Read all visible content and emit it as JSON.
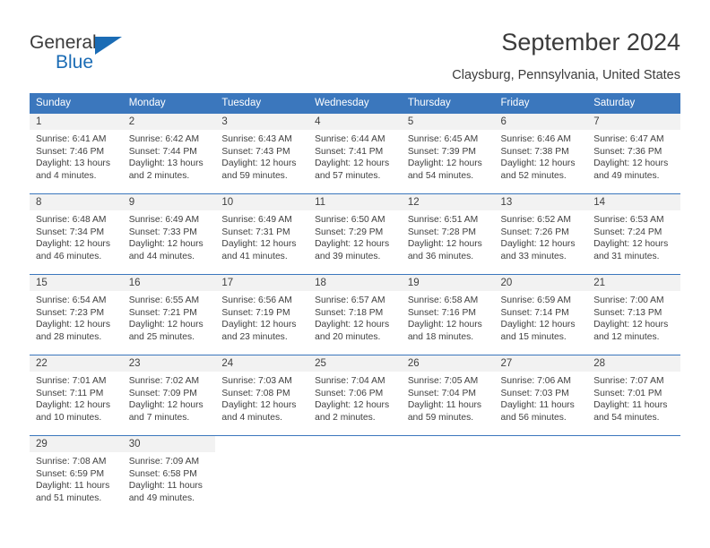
{
  "brand": {
    "name_part1": "General",
    "name_part2": "Blue",
    "triangle_color": "#1b6cb5"
  },
  "header": {
    "title": "September 2024",
    "subtitle": "Claysburg, Pennsylvania, United States"
  },
  "calendar": {
    "accent_color": "#3b77bd",
    "daynum_background": "#f2f2f2",
    "weekday_headers": [
      "Sunday",
      "Monday",
      "Tuesday",
      "Wednesday",
      "Thursday",
      "Friday",
      "Saturday"
    ],
    "weeks": [
      [
        {
          "day": "1",
          "sunrise": "Sunrise: 6:41 AM",
          "sunset": "Sunset: 7:46 PM",
          "daylight_line1": "Daylight: 13 hours",
          "daylight_line2": "and 4 minutes."
        },
        {
          "day": "2",
          "sunrise": "Sunrise: 6:42 AM",
          "sunset": "Sunset: 7:44 PM",
          "daylight_line1": "Daylight: 13 hours",
          "daylight_line2": "and 2 minutes."
        },
        {
          "day": "3",
          "sunrise": "Sunrise: 6:43 AM",
          "sunset": "Sunset: 7:43 PM",
          "daylight_line1": "Daylight: 12 hours",
          "daylight_line2": "and 59 minutes."
        },
        {
          "day": "4",
          "sunrise": "Sunrise: 6:44 AM",
          "sunset": "Sunset: 7:41 PM",
          "daylight_line1": "Daylight: 12 hours",
          "daylight_line2": "and 57 minutes."
        },
        {
          "day": "5",
          "sunrise": "Sunrise: 6:45 AM",
          "sunset": "Sunset: 7:39 PM",
          "daylight_line1": "Daylight: 12 hours",
          "daylight_line2": "and 54 minutes."
        },
        {
          "day": "6",
          "sunrise": "Sunrise: 6:46 AM",
          "sunset": "Sunset: 7:38 PM",
          "daylight_line1": "Daylight: 12 hours",
          "daylight_line2": "and 52 minutes."
        },
        {
          "day": "7",
          "sunrise": "Sunrise: 6:47 AM",
          "sunset": "Sunset: 7:36 PM",
          "daylight_line1": "Daylight: 12 hours",
          "daylight_line2": "and 49 minutes."
        }
      ],
      [
        {
          "day": "8",
          "sunrise": "Sunrise: 6:48 AM",
          "sunset": "Sunset: 7:34 PM",
          "daylight_line1": "Daylight: 12 hours",
          "daylight_line2": "and 46 minutes."
        },
        {
          "day": "9",
          "sunrise": "Sunrise: 6:49 AM",
          "sunset": "Sunset: 7:33 PM",
          "daylight_line1": "Daylight: 12 hours",
          "daylight_line2": "and 44 minutes."
        },
        {
          "day": "10",
          "sunrise": "Sunrise: 6:49 AM",
          "sunset": "Sunset: 7:31 PM",
          "daylight_line1": "Daylight: 12 hours",
          "daylight_line2": "and 41 minutes."
        },
        {
          "day": "11",
          "sunrise": "Sunrise: 6:50 AM",
          "sunset": "Sunset: 7:29 PM",
          "daylight_line1": "Daylight: 12 hours",
          "daylight_line2": "and 39 minutes."
        },
        {
          "day": "12",
          "sunrise": "Sunrise: 6:51 AM",
          "sunset": "Sunset: 7:28 PM",
          "daylight_line1": "Daylight: 12 hours",
          "daylight_line2": "and 36 minutes."
        },
        {
          "day": "13",
          "sunrise": "Sunrise: 6:52 AM",
          "sunset": "Sunset: 7:26 PM",
          "daylight_line1": "Daylight: 12 hours",
          "daylight_line2": "and 33 minutes."
        },
        {
          "day": "14",
          "sunrise": "Sunrise: 6:53 AM",
          "sunset": "Sunset: 7:24 PM",
          "daylight_line1": "Daylight: 12 hours",
          "daylight_line2": "and 31 minutes."
        }
      ],
      [
        {
          "day": "15",
          "sunrise": "Sunrise: 6:54 AM",
          "sunset": "Sunset: 7:23 PM",
          "daylight_line1": "Daylight: 12 hours",
          "daylight_line2": "and 28 minutes."
        },
        {
          "day": "16",
          "sunrise": "Sunrise: 6:55 AM",
          "sunset": "Sunset: 7:21 PM",
          "daylight_line1": "Daylight: 12 hours",
          "daylight_line2": "and 25 minutes."
        },
        {
          "day": "17",
          "sunrise": "Sunrise: 6:56 AM",
          "sunset": "Sunset: 7:19 PM",
          "daylight_line1": "Daylight: 12 hours",
          "daylight_line2": "and 23 minutes."
        },
        {
          "day": "18",
          "sunrise": "Sunrise: 6:57 AM",
          "sunset": "Sunset: 7:18 PM",
          "daylight_line1": "Daylight: 12 hours",
          "daylight_line2": "and 20 minutes."
        },
        {
          "day": "19",
          "sunrise": "Sunrise: 6:58 AM",
          "sunset": "Sunset: 7:16 PM",
          "daylight_line1": "Daylight: 12 hours",
          "daylight_line2": "and 18 minutes."
        },
        {
          "day": "20",
          "sunrise": "Sunrise: 6:59 AM",
          "sunset": "Sunset: 7:14 PM",
          "daylight_line1": "Daylight: 12 hours",
          "daylight_line2": "and 15 minutes."
        },
        {
          "day": "21",
          "sunrise": "Sunrise: 7:00 AM",
          "sunset": "Sunset: 7:13 PM",
          "daylight_line1": "Daylight: 12 hours",
          "daylight_line2": "and 12 minutes."
        }
      ],
      [
        {
          "day": "22",
          "sunrise": "Sunrise: 7:01 AM",
          "sunset": "Sunset: 7:11 PM",
          "daylight_line1": "Daylight: 12 hours",
          "daylight_line2": "and 10 minutes."
        },
        {
          "day": "23",
          "sunrise": "Sunrise: 7:02 AM",
          "sunset": "Sunset: 7:09 PM",
          "daylight_line1": "Daylight: 12 hours",
          "daylight_line2": "and 7 minutes."
        },
        {
          "day": "24",
          "sunrise": "Sunrise: 7:03 AM",
          "sunset": "Sunset: 7:08 PM",
          "daylight_line1": "Daylight: 12 hours",
          "daylight_line2": "and 4 minutes."
        },
        {
          "day": "25",
          "sunrise": "Sunrise: 7:04 AM",
          "sunset": "Sunset: 7:06 PM",
          "daylight_line1": "Daylight: 12 hours",
          "daylight_line2": "and 2 minutes."
        },
        {
          "day": "26",
          "sunrise": "Sunrise: 7:05 AM",
          "sunset": "Sunset: 7:04 PM",
          "daylight_line1": "Daylight: 11 hours",
          "daylight_line2": "and 59 minutes."
        },
        {
          "day": "27",
          "sunrise": "Sunrise: 7:06 AM",
          "sunset": "Sunset: 7:03 PM",
          "daylight_line1": "Daylight: 11 hours",
          "daylight_line2": "and 56 minutes."
        },
        {
          "day": "28",
          "sunrise": "Sunrise: 7:07 AM",
          "sunset": "Sunset: 7:01 PM",
          "daylight_line1": "Daylight: 11 hours",
          "daylight_line2": "and 54 minutes."
        }
      ],
      [
        {
          "day": "29",
          "sunrise": "Sunrise: 7:08 AM",
          "sunset": "Sunset: 6:59 PM",
          "daylight_line1": "Daylight: 11 hours",
          "daylight_line2": "and 51 minutes."
        },
        {
          "day": "30",
          "sunrise": "Sunrise: 7:09 AM",
          "sunset": "Sunset: 6:58 PM",
          "daylight_line1": "Daylight: 11 hours",
          "daylight_line2": "and 49 minutes."
        },
        {
          "day": "",
          "sunrise": "",
          "sunset": "",
          "daylight_line1": "",
          "daylight_line2": ""
        },
        {
          "day": "",
          "sunrise": "",
          "sunset": "",
          "daylight_line1": "",
          "daylight_line2": ""
        },
        {
          "day": "",
          "sunrise": "",
          "sunset": "",
          "daylight_line1": "",
          "daylight_line2": ""
        },
        {
          "day": "",
          "sunrise": "",
          "sunset": "",
          "daylight_line1": "",
          "daylight_line2": ""
        },
        {
          "day": "",
          "sunrise": "",
          "sunset": "",
          "daylight_line1": "",
          "daylight_line2": ""
        }
      ]
    ]
  }
}
